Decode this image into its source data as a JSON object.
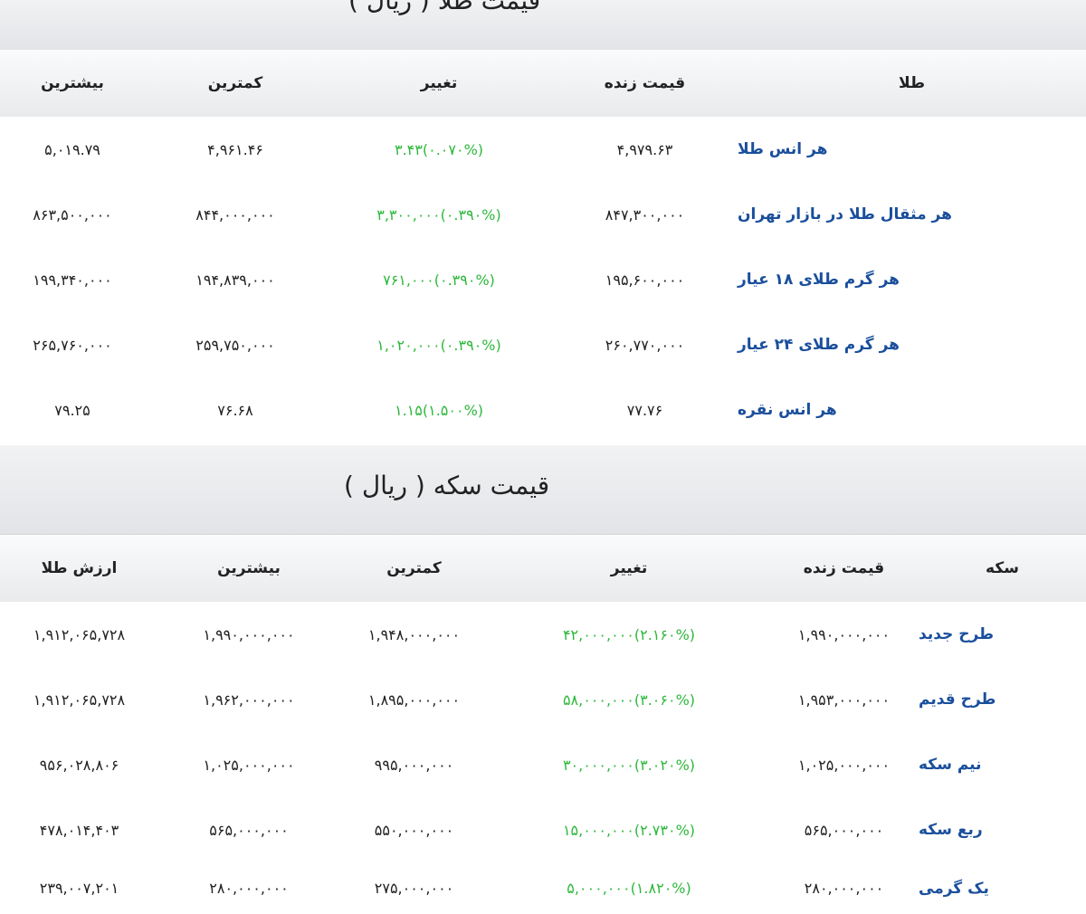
{
  "gold_section": {
    "title": "قیمت طلا ( ریال )",
    "headers": {
      "name": "طلا",
      "live": "قیمت زنده",
      "change": "تغییر",
      "low": "کمترین",
      "high": "بیشترین"
    },
    "rows": [
      {
        "name": "هر انس طلا",
        "live": "۴,۹۷۹.۶۳",
        "change": "(۰.۰۷۰%)۳.۴۳",
        "low": "۴,۹۶۱.۴۶",
        "high": "۵,۰۱۹.۷۹"
      },
      {
        "name": "هر مثقال طلا در بازار تهران",
        "live": "۸۴۷,۳۰۰,۰۰۰",
        "change": "(۰.۳۹۰%)۳,۳۰۰,۰۰۰",
        "low": "۸۴۴,۰۰۰,۰۰۰",
        "high": "۸۶۳,۵۰۰,۰۰۰"
      },
      {
        "name": "هر گرم طلای ۱۸ عیار",
        "live": "۱۹۵,۶۰۰,۰۰۰",
        "change": "(۰.۳۹۰%)۷۶۱,۰۰۰",
        "low": "۱۹۴,۸۳۹,۰۰۰",
        "high": "۱۹۹,۳۴۰,۰۰۰"
      },
      {
        "name": "هر گرم طلای ۲۴ عیار",
        "live": "۲۶۰,۷۷۰,۰۰۰",
        "change": "(۰.۳۹۰%)۱,۰۲۰,۰۰۰",
        "low": "۲۵۹,۷۵۰,۰۰۰",
        "high": "۲۶۵,۷۶۰,۰۰۰"
      },
      {
        "name": "هر انس نقره",
        "live": "۷۷.۷۶",
        "change": "(۱.۵۰۰%)۱.۱۵",
        "low": "۷۶.۶۸",
        "high": "۷۹.۲۵"
      }
    ]
  },
  "coin_section": {
    "title": "قیمت سکه ( ریال )",
    "headers": {
      "name": "سکه",
      "live": "قیمت زنده",
      "change": "تغییر",
      "low": "کمترین",
      "high": "بیشترین",
      "gold_value": "ارزش طلا"
    },
    "rows": [
      {
        "name": "طرح جدید",
        "live": "۱,۹۹۰,۰۰۰,۰۰۰",
        "change": "(۲.۱۶۰%)۴۲,۰۰۰,۰۰۰",
        "low": "۱,۹۴۸,۰۰۰,۰۰۰",
        "high": "۱,۹۹۰,۰۰۰,۰۰۰",
        "gold_value": "۱,۹۱۲,۰۶۵,۷۲۸"
      },
      {
        "name": "طرح قدیم",
        "live": "۱,۹۵۳,۰۰۰,۰۰۰",
        "change": "(۳.۰۶۰%)۵۸,۰۰۰,۰۰۰",
        "low": "۱,۸۹۵,۰۰۰,۰۰۰",
        "high": "۱,۹۶۲,۰۰۰,۰۰۰",
        "gold_value": "۱,۹۱۲,۰۶۵,۷۲۸"
      },
      {
        "name": "نیم سکه",
        "live": "۱,۰۲۵,۰۰۰,۰۰۰",
        "change": "(۳.۰۲۰%)۳۰,۰۰۰,۰۰۰",
        "low": "۹۹۵,۰۰۰,۰۰۰",
        "high": "۱,۰۲۵,۰۰۰,۰۰۰",
        "gold_value": "۹۵۶,۰۲۸,۸۰۶"
      },
      {
        "name": "ربع سکه",
        "live": "۵۶۵,۰۰۰,۰۰۰",
        "change": "(۲.۷۳۰%)۱۵,۰۰۰,۰۰۰",
        "low": "۵۵۰,۰۰۰,۰۰۰",
        "high": "۵۶۵,۰۰۰,۰۰۰",
        "gold_value": "۴۷۸,۰۱۴,۴۰۳"
      },
      {
        "name": "یک گرمی",
        "live": "۲۸۰,۰۰۰,۰۰۰",
        "change": "(۱.۸۲۰%)۵,۰۰۰,۰۰۰",
        "low": "۲۷۵,۰۰۰,۰۰۰",
        "high": "۲۸۰,۰۰۰,۰۰۰",
        "gold_value": "۲۳۹,۰۰۷,۲۰۱"
      }
    ]
  }
}
